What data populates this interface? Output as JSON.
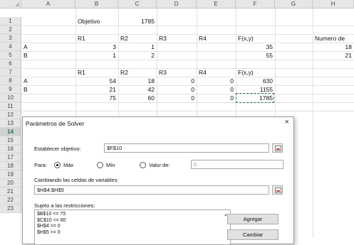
{
  "columns": [
    "A",
    "B",
    "C",
    "D",
    "E",
    "F",
    "G",
    "H"
  ],
  "rows": [
    "1",
    "2",
    "3",
    "4",
    "5",
    "6",
    "7",
    "8",
    "9",
    "10",
    "11",
    "12",
    "13",
    "14",
    "15",
    "16",
    "17",
    "18",
    "19",
    "20",
    "21",
    "22",
    "23"
  ],
  "active_row": "14",
  "cells": {
    "b1": "Objetivo",
    "c1": "1785",
    "b3": "R1",
    "c3": "R2",
    "d3": "R3",
    "e3": "R4",
    "f3": "F(x,y)",
    "h3": "Numero de",
    "a4": "A",
    "b4": "3",
    "c4": "1",
    "f4": "35",
    "h4": "18",
    "a5": "B",
    "b5": "1",
    "c5": "2",
    "f5": "55",
    "h5": "21",
    "b7": "R1",
    "c7": "R2",
    "d7": "R3",
    "e7": "R4",
    "f7": "F(x,y)",
    "a8": "A",
    "b8": "54",
    "c8": "18",
    "d8": "0",
    "e8": "0",
    "f8": "630",
    "a9": "B",
    "b9": "21",
    "c9": "42",
    "d9": "0",
    "e9": "0",
    "f9": "1155",
    "b10": "75",
    "c10": "60",
    "d10": "0",
    "e10": "0",
    "f10": "1785"
  },
  "dialog": {
    "title": "Parámetros de Solver",
    "close": "×",
    "objective_label": "Establecer objetivo:",
    "objective_value": "$F$10",
    "to_label": "Para:",
    "max_label": "Máx",
    "min_label": "Mín",
    "value_label": "Valor de:",
    "value_input": "0",
    "selected_option": "max",
    "changing_label": "Cambiando las celdas de variables:",
    "changing_value": "$H$4:$H$5",
    "constraints_label": "Sujeto a las restricciones:",
    "constraints": [
      "$B$10 <= 75",
      "$C$10 <= 60",
      "$H$4 >= 0",
      "$H$5 >= 0"
    ],
    "add_button": "Agregar",
    "change_button": "Cambiar"
  }
}
